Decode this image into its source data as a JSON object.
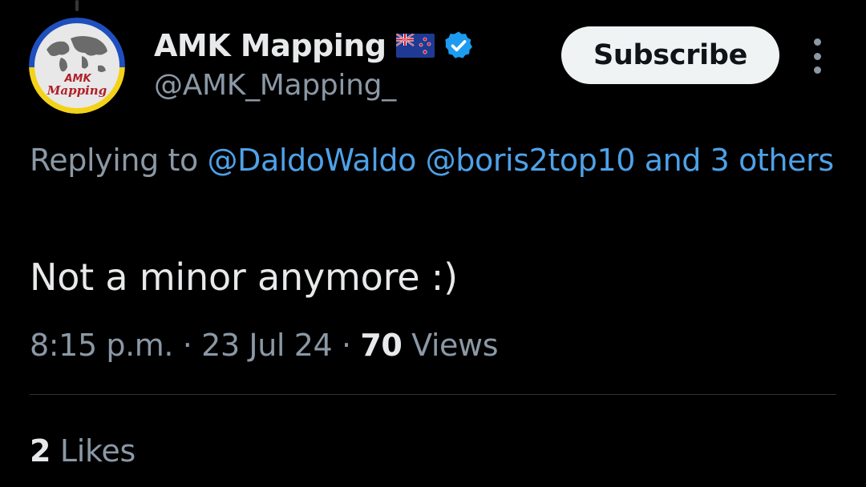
{
  "author": {
    "display_name": "AMK Mapping",
    "handle": "@AMK_Mapping_",
    "avatar_text_line1": "AMK",
    "avatar_text_line2": "Mapping",
    "flag_icon": "new-zealand-flag-icon",
    "verified_icon": "verified-badge-icon"
  },
  "header": {
    "subscribe_label": "Subscribe",
    "more_icon": "more-vertical-icon"
  },
  "reply": {
    "prefix": "Replying to",
    "mention_1": "@DaldoWaldo",
    "mention_2": "@boris2top10",
    "others": "and 3 others"
  },
  "tweet": {
    "text": "Not a minor anymore :)"
  },
  "meta": {
    "time": "8:15 p.m.",
    "separator": "·",
    "date": "23 Jul 24",
    "views_count": "70",
    "views_label": "Views"
  },
  "stats": {
    "likes_count": "2",
    "likes_label": "Likes"
  },
  "colors": {
    "background": "#000000",
    "text_primary": "#e7e9ea",
    "text_secondary": "#8b98a5",
    "link": "#4ea1e8",
    "verified": "#1d9bf0",
    "button_bg": "#eff3f4"
  }
}
